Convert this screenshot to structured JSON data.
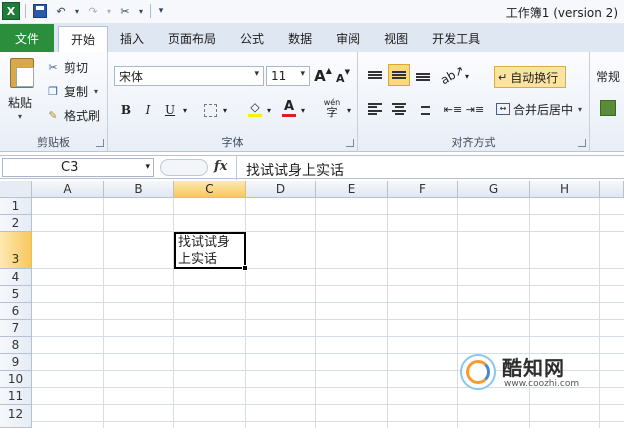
{
  "window": {
    "title": "工作簿1 (version 2)"
  },
  "qat": {
    "app_icon_letter": "X"
  },
  "tabs": [
    {
      "label": "文件"
    },
    {
      "label": "开始"
    },
    {
      "label": "插入"
    },
    {
      "label": "页面布局"
    },
    {
      "label": "公式"
    },
    {
      "label": "数据"
    },
    {
      "label": "审阅"
    },
    {
      "label": "视图"
    },
    {
      "label": "开发工具"
    }
  ],
  "clipboard": {
    "paste_label": "粘贴",
    "cut_label": "剪切",
    "copy_label": "复制",
    "format_painter_label": "格式刷",
    "group_label": "剪贴板"
  },
  "font": {
    "name": "宋体",
    "size": "11",
    "grow": "A",
    "shrink": "A",
    "bold": "B",
    "italic": "I",
    "underline": "U",
    "font_color_letter": "A",
    "phonetic": "wén",
    "group_label": "字体"
  },
  "alignment": {
    "wrap_text_label": "自动换行",
    "merge_center_label": "合并后居中",
    "group_label": "对齐方式"
  },
  "number": {
    "format_label": "常规"
  },
  "formula_bar": {
    "name_box": "C3",
    "fx_label": "fx",
    "value": "找试试身上实话"
  },
  "sheet": {
    "columns": [
      "A",
      "B",
      "C",
      "D",
      "E",
      "F",
      "G",
      "H"
    ],
    "rows": [
      "1",
      "2",
      "3",
      "4",
      "5",
      "6",
      "7",
      "8",
      "9",
      "10",
      "11",
      "12"
    ],
    "selected_column": "C",
    "selected_row": "3",
    "active_cell_text_line1": "找试试身",
    "active_cell_text_line2": "上实话"
  },
  "watermark": {
    "name": "酷知网",
    "url": "www.coozhi.com"
  },
  "colors": {
    "file_tab": "#2a8e3c",
    "selected_header": "#f7c85d",
    "wrap_text_active": "#fce3a0"
  }
}
